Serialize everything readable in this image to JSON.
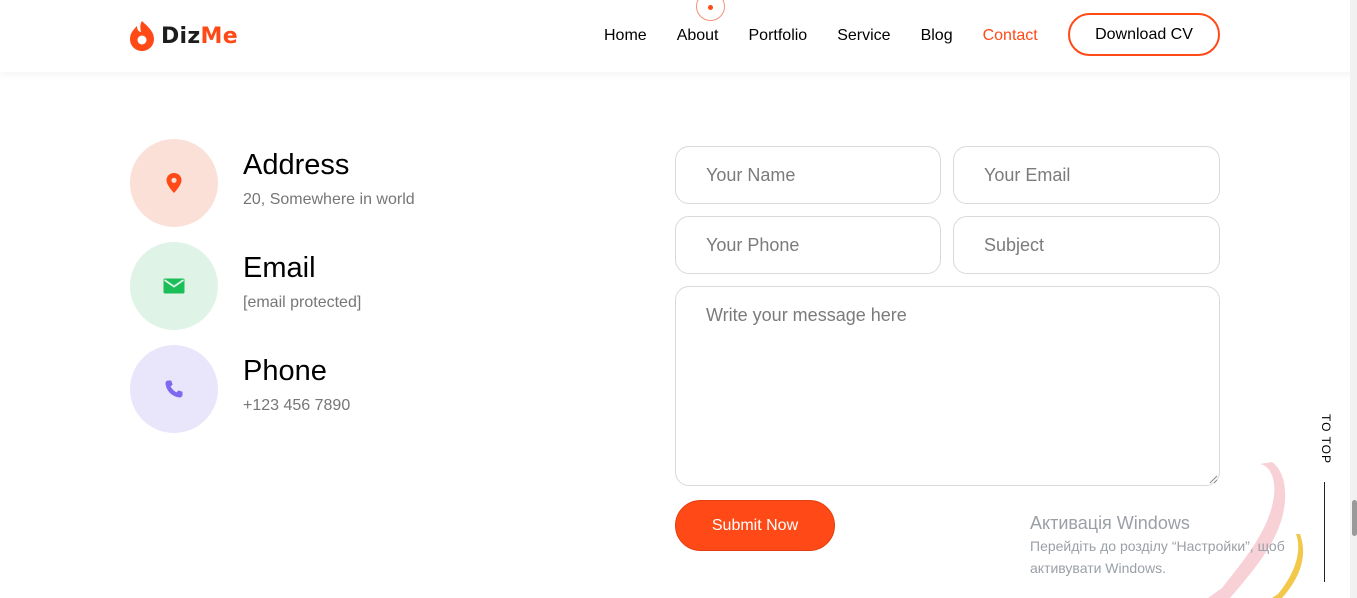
{
  "header": {
    "logo_text_1": "Diz",
    "logo_text_2": "Me",
    "nav": [
      {
        "label": "Home",
        "active": false
      },
      {
        "label": "About",
        "active": false
      },
      {
        "label": "Portfolio",
        "active": false
      },
      {
        "label": "Service",
        "active": false
      },
      {
        "label": "Blog",
        "active": false
      },
      {
        "label": "Contact",
        "active": true
      }
    ],
    "download_label": "Download CV"
  },
  "contact": {
    "items": [
      {
        "title": "Address",
        "value": "20, Somewhere in world",
        "icon": "map-pin-icon",
        "bg": "#fbe0d8",
        "color": "#ff4a17"
      },
      {
        "title": "Email",
        "value": "[email protected]",
        "icon": "envelope-icon",
        "bg": "#dff4e7",
        "color": "#1cbe59"
      },
      {
        "title": "Phone",
        "value": "+123 456 7890",
        "icon": "phone-icon",
        "bg": "#e9e6fc",
        "color": "#8067f0"
      }
    ]
  },
  "form": {
    "name_placeholder": "Your Name",
    "email_placeholder": "Your Email",
    "phone_placeholder": "Your Phone",
    "subject_placeholder": "Subject",
    "message_placeholder": "Write your message here",
    "submit_label": "Submit Now"
  },
  "totop_label": "TO TOP",
  "windows_activation": {
    "title": "Активація Windows",
    "line1": "Перейдіть до розділу “Настройки”, щоб",
    "line2": "активувати Windows."
  },
  "colors": {
    "accent": "#ff4a17"
  }
}
